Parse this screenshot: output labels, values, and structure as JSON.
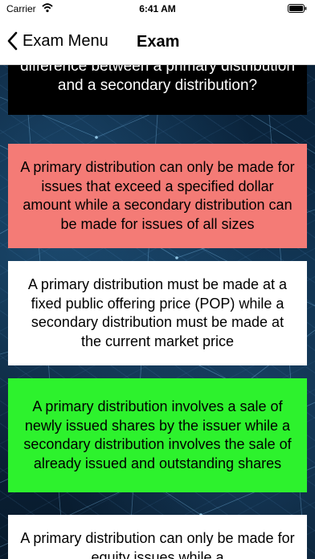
{
  "status_bar": {
    "carrier": "Carrier",
    "time": "6:41 AM",
    "wifi_icon": "wifi-icon",
    "battery_icon": "battery-icon"
  },
  "nav": {
    "back_label": "Exam Menu",
    "back_icon": "chevron-left-icon",
    "title": "Exam"
  },
  "question": {
    "text": "difference between a primary distribution and a secondary distribution?"
  },
  "answers": [
    {
      "text": "A primary distribution can only be made for issues that exceed a specified dollar amount while a secondary distribution can be made for issues of all sizes",
      "state": "incorrect",
      "color": "#f47b76"
    },
    {
      "text": "A primary distribution must be made at a fixed public offering price (POP) while a secondary distribution must be made at the current market price",
      "state": "neutral",
      "color": "#ffffff"
    },
    {
      "text": "A primary distribution involves a sale of newly issued shares by the issuer while a secondary distribution involves the sale of already issued and outstanding shares",
      "state": "correct",
      "color": "#2df22d"
    },
    {
      "text": "A primary distribution can only be made for equity issues while a",
      "state": "neutral",
      "color": "#ffffff"
    }
  ]
}
